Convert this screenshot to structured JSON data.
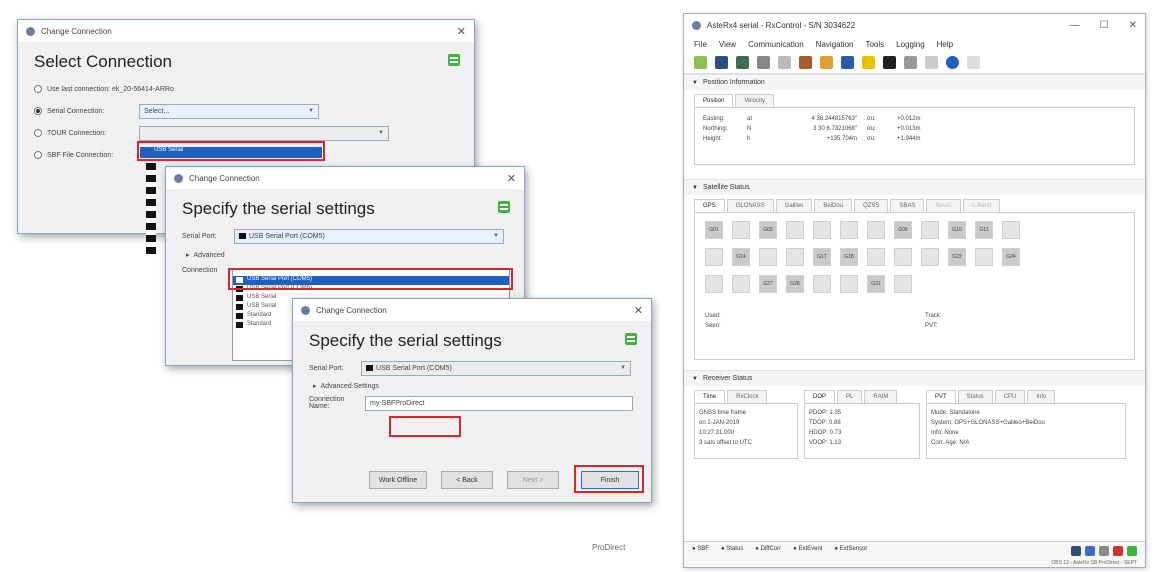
{
  "dialog1": {
    "title": "Change Connection",
    "heading": "Select Connection",
    "options": [
      {
        "label": "Use last connection: ek_20-56414-ARRo"
      },
      {
        "label": "Serial Connection:",
        "value": "Select..."
      },
      {
        "label": "TOUR Connection:",
        "value": "USB Serial"
      },
      {
        "label": "SBF File Connection:"
      }
    ]
  },
  "dialog2": {
    "title": "Change Connection",
    "heading": "Specify the serial settings",
    "serial_port_label": "Serial Port:",
    "serial_port_value": "USB Serial Port (COM5)",
    "advanced_label": "Advanced",
    "connection_label": "Connection",
    "list_items": [
      "USB Serial Port (COM5)",
      "USB Serial Port (COM6)",
      "USB Serial",
      "USB Serial",
      "Standard",
      "Standard"
    ]
  },
  "dialog3": {
    "title": "Change Connection",
    "heading": "Specify the serial settings",
    "serial_port_label": "Serial Port:",
    "serial_port_value": "USB Serial Port (COM5)",
    "advanced_label": "Advanced Settings",
    "connection_name_label": "Connection Name:",
    "connection_name_value": "my-SBFProDirect",
    "buttons": {
      "offline": "Work Offline",
      "back": "< Back",
      "next": "Next >",
      "finish": "Finish"
    }
  },
  "app": {
    "title": "AsteRx4 serial - RxControl - S/N 3034622",
    "menu": [
      "File",
      "View",
      "Communication",
      "Navigation",
      "Tools",
      "Logging",
      "Help"
    ],
    "position": {
      "header": "Position Information",
      "tabs": [
        "Position",
        "Velocity"
      ],
      "rows": [
        {
          "k": "Easting:",
          "a": "at",
          "v": "4 36.244815763\"",
          "u": "σu:",
          "e": "+0.012m"
        },
        {
          "k": "Northing:",
          "a": "N",
          "v": "3 30 6.7321068\"",
          "u": "σu:",
          "e": "+0.013m"
        },
        {
          "k": "Height:",
          "a": "h",
          "v": "+135.704m",
          "u": "σu:",
          "e": "+1.944m"
        }
      ]
    },
    "satellite": {
      "header": "Satellite Status",
      "tabs": [
        "GPS",
        "GLONASS",
        "Galileo",
        "BeiDou",
        "QZSS",
        "SBAS",
        "NavIC",
        "L-Band"
      ],
      "row1": [
        "G01",
        "",
        "G03",
        "",
        "",
        "",
        "",
        "G08",
        "",
        "G10",
        "G11",
        ""
      ],
      "row2": [
        "",
        "G14",
        "",
        "",
        "G17",
        "G18",
        "",
        "",
        "",
        "G22",
        "",
        "G24"
      ],
      "row3": [
        "",
        "",
        "G27",
        "G28",
        "",
        "",
        "G31",
        ""
      ],
      "summary_left": [
        "Used:",
        "Seen:"
      ],
      "summary_right": [
        "Track:",
        "PVT:"
      ]
    },
    "receiver": {
      "header": "Receiver Status",
      "tabs_left": [
        "Time",
        "RxClock"
      ],
      "tabs_mid": [
        "DOP",
        "PL",
        "RAIM"
      ],
      "tabs_right": [
        "PVT",
        "Status",
        "CPU",
        "Info"
      ],
      "time_lines": [
        "GNSS time frame",
        "on 2-JAN-2019",
        "10:27:31.000",
        "3 sats offset to UTC"
      ],
      "dop_lines": [
        "PDOP: 1.35",
        "TDOP: 0.88",
        "HDOP: 0.73",
        "VDOP: 1.13"
      ],
      "pvt_lines": [
        "Mode: Standalone",
        "System: GPS+GLONASS+Galileo+BeiDou",
        "Info: None",
        "Corr. Age: N/A"
      ]
    },
    "status_items": [
      "SBF",
      "Status",
      "DiffCorr",
      "ExtEvent",
      "ExtSensor"
    ],
    "status_bottom": "OBS 12 - AsteRx SB ProDirect - SEPT"
  },
  "caption": "ProDirect"
}
